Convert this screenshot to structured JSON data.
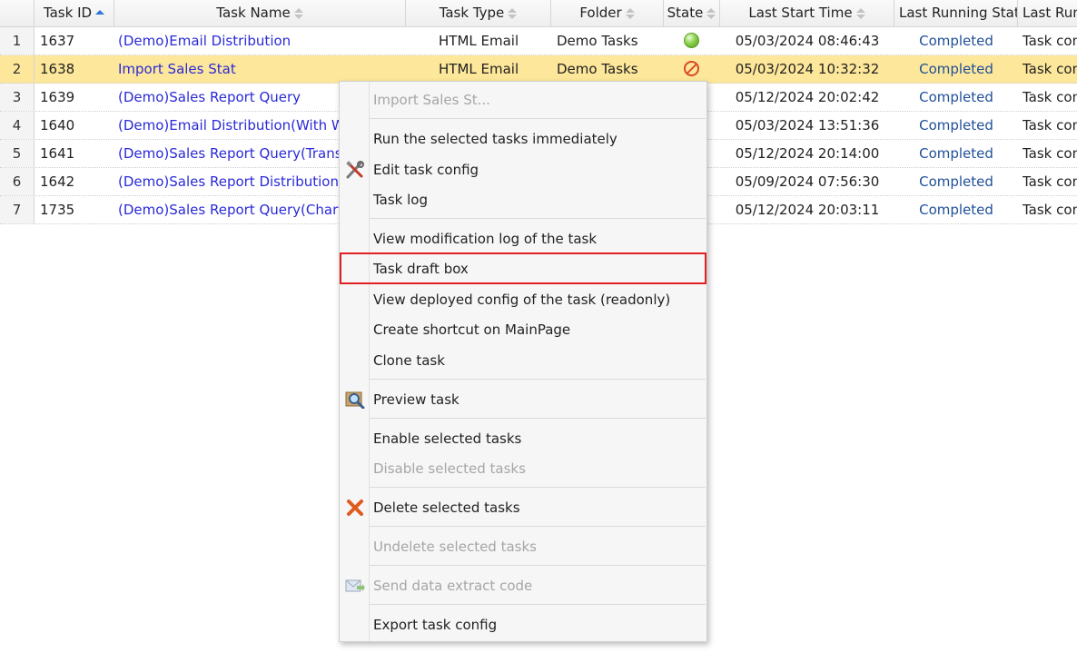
{
  "grid": {
    "columns": [
      {
        "label": "Task ID",
        "sort": "asc"
      },
      {
        "label": "Task Name",
        "sort": "none"
      },
      {
        "label": "Task Type",
        "sort": "none"
      },
      {
        "label": "Folder",
        "sort": "none"
      },
      {
        "label": "State",
        "sort": "none"
      },
      {
        "label": "Last Start Time",
        "sort": "none"
      },
      {
        "label": "Last Running State",
        "sort": "none"
      },
      {
        "label": "Last Running Info",
        "sort": "none"
      }
    ],
    "rows": [
      {
        "num": "1",
        "id": "1637",
        "name": "(Demo)Email Distribution",
        "type": "HTML Email",
        "folder": "Demo Tasks",
        "state": "ok",
        "start": "05/03/2024 08:46:43",
        "status": "Completed",
        "info": "Task completed"
      },
      {
        "num": "2",
        "id": "1638",
        "name": "Import Sales Stat",
        "type": "HTML Email",
        "folder": "Demo Tasks",
        "state": "disabled",
        "start": "05/03/2024 10:32:32",
        "status": "Completed",
        "info": "Task completed"
      },
      {
        "num": "3",
        "id": "1639",
        "name": "(Demo)Sales Report Query",
        "type": "",
        "folder": "",
        "state": "",
        "start": "05/12/2024 20:02:42",
        "status": "Completed",
        "info": "Task completed"
      },
      {
        "num": "4",
        "id": "1640",
        "name": "(Demo)Email Distribution(With Watermark)",
        "type": "",
        "folder": "",
        "state": "",
        "start": "05/03/2024 13:51:36",
        "status": "Completed",
        "info": "Task completed"
      },
      {
        "num": "5",
        "id": "1641",
        "name": "(Demo)Sales Report Query(Transpose)",
        "type": "",
        "folder": "",
        "state": "",
        "start": "05/12/2024 20:14:00",
        "status": "Completed",
        "info": "Task completed"
      },
      {
        "num": "6",
        "id": "1642",
        "name": "(Demo)Sales Report Distribution",
        "type": "",
        "folder": "",
        "state": "",
        "start": "05/09/2024 07:56:30",
        "status": "Completed",
        "info": "Task completed"
      },
      {
        "num": "7",
        "id": "1735",
        "name": "(Demo)Sales Report Query(Chart)",
        "type": "",
        "folder": "",
        "state": "",
        "start": "05/12/2024 20:03:11",
        "status": "Completed",
        "info": "Task completed"
      }
    ],
    "selected_row_color": "#fde79a"
  },
  "context_menu": {
    "title": "Import Sales St...",
    "items": [
      {
        "label": "Run the selected tasks immediately",
        "disabled": false,
        "icon": ""
      },
      {
        "label": "Edit task config",
        "disabled": false,
        "icon": "tools-icon"
      },
      {
        "label": "Task log",
        "disabled": false,
        "icon": ""
      },
      {
        "label": "View modification log of the task",
        "disabled": false,
        "icon": ""
      },
      {
        "label": "Task draft box",
        "disabled": false,
        "icon": "",
        "highlighted": true
      },
      {
        "label": "View deployed config of the task (readonly)",
        "disabled": false,
        "icon": ""
      },
      {
        "label": "Create shortcut on MainPage",
        "disabled": false,
        "icon": ""
      },
      {
        "label": "Clone task",
        "disabled": false,
        "icon": ""
      },
      {
        "label": "Preview task",
        "disabled": false,
        "icon": "preview-icon"
      },
      {
        "label": "Enable selected tasks",
        "disabled": false,
        "icon": ""
      },
      {
        "label": "Disable selected tasks",
        "disabled": true,
        "icon": ""
      },
      {
        "label": "Delete selected tasks",
        "disabled": false,
        "icon": "delete-icon"
      },
      {
        "label": "Undelete selected tasks",
        "disabled": true,
        "icon": ""
      },
      {
        "label": "Send data extract code",
        "disabled": true,
        "icon": "mail-icon"
      },
      {
        "label": "Export task config",
        "disabled": false,
        "icon": ""
      }
    ],
    "highlight_color": "#e02020"
  }
}
